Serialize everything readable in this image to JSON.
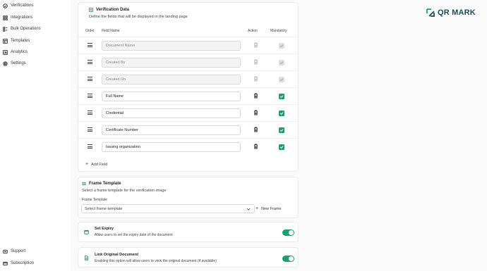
{
  "sidebar": {
    "items": [
      {
        "label": "Verifications",
        "icon": "check-circle-icon"
      },
      {
        "label": "Integrations",
        "icon": "grid-icon"
      },
      {
        "label": "Bulk Operations",
        "icon": "stack-icon"
      },
      {
        "label": "Templates",
        "icon": "template-icon"
      },
      {
        "label": "Analytics",
        "icon": "chart-icon"
      },
      {
        "label": "Settings",
        "icon": "gear-icon"
      }
    ],
    "footer": [
      {
        "label": "Support",
        "icon": "support-icon"
      },
      {
        "label": "Subscription",
        "icon": "card-icon"
      }
    ]
  },
  "logo": {
    "text": "QR MARK",
    "color": "#1aa06d"
  },
  "verification_data": {
    "title": "Verification Data",
    "subtitle": "Define the fields that will be displayed in the landing page",
    "columns": {
      "order": "Order",
      "field_name": "Field Name",
      "action": "Action",
      "mandatory": "Mandatory"
    },
    "fields": [
      {
        "value": "Document Name",
        "locked": true,
        "mandatory": true
      },
      {
        "value": "Created By",
        "locked": true,
        "mandatory": true
      },
      {
        "value": "Created On",
        "locked": true,
        "mandatory": true
      },
      {
        "value": "Full Name",
        "locked": false,
        "mandatory": true
      },
      {
        "value": "Credential",
        "locked": false,
        "mandatory": true
      },
      {
        "value": "Certificate Number",
        "locked": false,
        "mandatory": true
      },
      {
        "value": "Issuing organization",
        "locked": false,
        "mandatory": true
      }
    ],
    "add_field_label": "Add Field"
  },
  "frame_template": {
    "title": "Frame Template",
    "subtitle": "Select a frame template for the verification image",
    "select_label": "Frame Template",
    "select_placeholder": "Select frame template",
    "new_frame_label": "New Frame"
  },
  "set_expiry": {
    "title": "Set Expiry",
    "description": "Allow users to set the expiry date of the document",
    "enabled": true
  },
  "link_original": {
    "title": "Link Original Document",
    "description": "Enabling this option will allow users to view the original document (if available)",
    "enabled": true
  },
  "accent_color": "#1aa06d"
}
